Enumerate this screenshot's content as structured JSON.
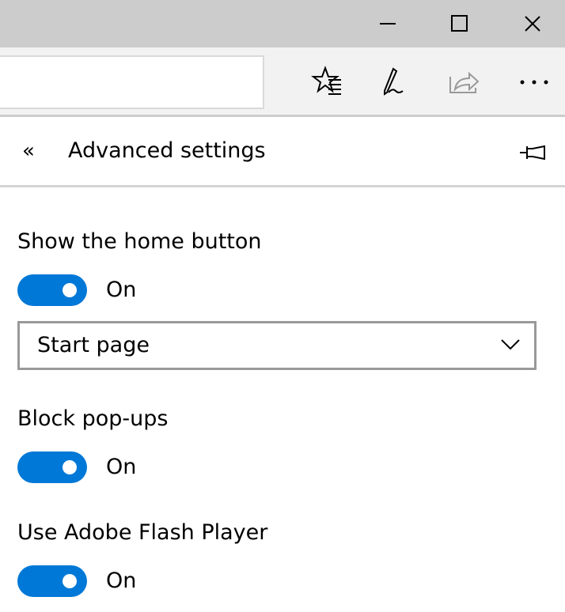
{
  "window_controls": {
    "minimize": "minimize-icon",
    "maximize": "maximize-icon",
    "close": "close-icon"
  },
  "toolbar": {
    "address_value": "",
    "icons": [
      "favorites-star-list-icon",
      "pen-note-icon",
      "share-icon",
      "more-icon"
    ]
  },
  "panel": {
    "back_icon": "«",
    "title": "Advanced settings",
    "settings": [
      {
        "label": "Show the home button",
        "state": "On",
        "on": true
      },
      {
        "label": "Block pop-ups",
        "state": "On",
        "on": true
      },
      {
        "label": "Use Adobe Flash Player",
        "state": "On",
        "on": true
      }
    ],
    "home_select": {
      "value": "Start page"
    }
  },
  "colors": {
    "accent": "#0078d7",
    "titlebar": "#cccccc",
    "toolbar": "#f2f2f2"
  }
}
